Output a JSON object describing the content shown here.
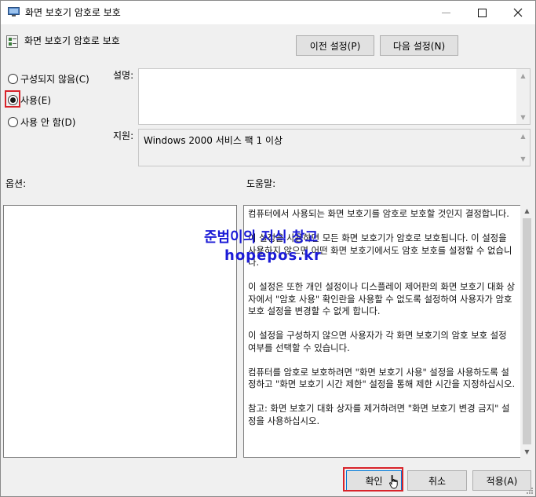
{
  "window": {
    "title": "화면 보호기 암호로 보호"
  },
  "header": {
    "title": "화면 보호기 암호로 보호",
    "prev_button": "이전 설정(P)",
    "next_button": "다음 설정(N)"
  },
  "state": {
    "options": [
      {
        "label": "구성되지 않음(C)",
        "checked": false
      },
      {
        "label": "사용(E)",
        "checked": true
      },
      {
        "label": "사용 안 함(D)",
        "checked": false
      }
    ]
  },
  "labels": {
    "description": "설명:",
    "supported_on": "지원:",
    "options": "옵션:",
    "help": "도움말:"
  },
  "supported_on_text": "Windows 2000 서비스 팩 1 이상",
  "help_text": "컴퓨터에서 사용되는 화면 보호기를 암호로 보호할 것인지 결정합니다.\n\n이 설정을 사용하면 모든 화면 보호기가 암호로 보호됩니다. 이 설정을 사용하지 않으면 어떤 화면 보호기에서도 암호 보호를 설정할 수 없습니다.\n\n이 설정은 또한 개인 설정이나 디스플레이 제어판의 화면 보호기 대화 상자에서 \"암호 사용\" 확인란을 사용할 수 없도록 설정하여 사용자가 암호 보호 설정을 변경할 수 없게 합니다.\n\n이 설정을 구성하지 않으면 사용자가 각 화면 보호기의 암호 보호 설정 여부를 선택할 수 있습니다.\n\n컴퓨터를 암호로 보호하려면 \"화면 보호기 사용\" 설정을 사용하도록 설정하고 \"화면 보호기 시간 제한\" 설정을 통해 제한 시간을 지정하십시오.\n\n참고: 화면 보호기 대화 상자를 제거하려면 \"화면 보호기 변경 금지\" 설정을 사용하십시오.",
  "watermark": {
    "line1": "준범이의 지식 창고",
    "line2": "hopepos.kr"
  },
  "footer": {
    "ok": "확인",
    "cancel": "취소",
    "apply": "적용(A)"
  },
  "colors": {
    "highlight": "#d8232a",
    "watermark": "#1b1bd6"
  },
  "icons": [
    "app-icon",
    "policy-icon",
    "minimize-icon",
    "maximize-icon",
    "close-icon",
    "mouse-cursor-icon"
  ]
}
